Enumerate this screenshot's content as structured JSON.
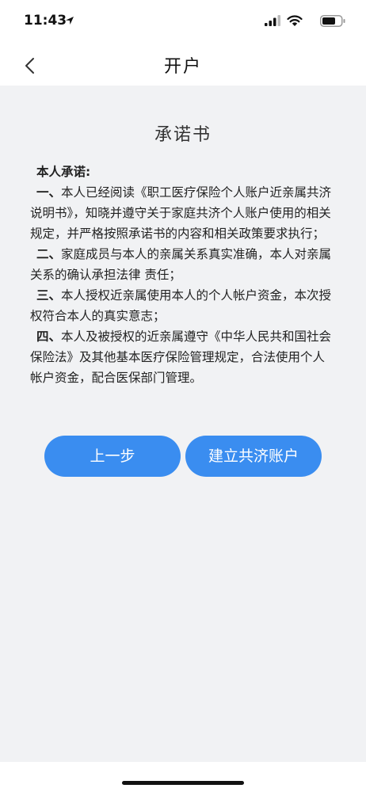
{
  "status_bar": {
    "time": "11:43"
  },
  "nav": {
    "title": "开户"
  },
  "document": {
    "title": "承诺书",
    "heading": "本人承诺:",
    "clauses": [
      {
        "num": "一、",
        "text": "本人已经阅读《职工医疗保险个人账户近亲属共济说明书》，知晓并遵守关于家庭共济个人账户使用的相关规定，并严格按照承诺书的内容和相关政策要求执行；"
      },
      {
        "num": "二、",
        "text": "家庭成员与本人的亲属关系真实准确，本人对亲属关系的确认承担法律 责任；"
      },
      {
        "num": "三、",
        "text": "本人授权近亲属使用本人的个人帐户资金，本次授权符合本人的真实意志；"
      },
      {
        "num": "四、",
        "text": "本人及被授权的近亲属遵守《中华人民共和国社会保险法》及其他基本医疗保险管理规定，合法使用个人帐户资金，配合医保部门管理。"
      }
    ]
  },
  "buttons": {
    "prev_label": "上一步",
    "create_label": "建立共济账户"
  },
  "colors": {
    "accent": "#3a8df0",
    "background": "#f1f2f4"
  }
}
